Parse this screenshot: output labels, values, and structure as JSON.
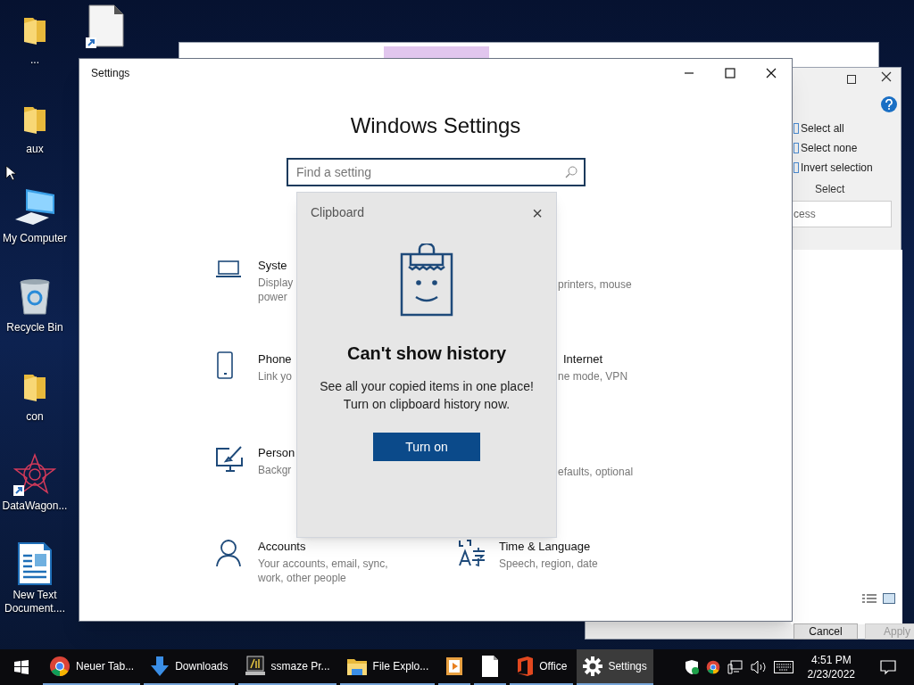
{
  "desktop_icons": [
    {
      "label": "..."
    },
    {
      "label": "aux"
    },
    {
      "label": "My Computer"
    },
    {
      "label": "Recycle Bin"
    },
    {
      "label": "con"
    },
    {
      "label": "DataWagon..."
    },
    {
      "label": "New Text Document...."
    }
  ],
  "explorer_window": {
    "ribbon_items": [
      "Select all",
      "Select none",
      "Invert selection"
    ],
    "group_label": "Select",
    "field_value": "cess",
    "buttons": [
      {
        "label": "Cancel",
        "disabled": false
      },
      {
        "label": "Apply",
        "disabled": true
      }
    ]
  },
  "settings_window": {
    "title": "Settings",
    "heading": "Windows Settings",
    "search": {
      "placeholder": "Find a setting"
    },
    "categories": [
      {
        "kind": "full",
        "title": "Syste",
        "description": "Display\npower"
      },
      {
        "kind": "partial",
        "description": "printers, mouse"
      },
      {
        "kind": "full",
        "title": "Phone",
        "description": "Link yo"
      },
      {
        "kind": "partial",
        "title": "Internet",
        "description": "ne mode, VPN"
      },
      {
        "kind": "full",
        "title": "Person",
        "description": "Backgr"
      },
      {
        "kind": "partial",
        "description": "efaults, optional"
      },
      {
        "kind": "full",
        "title": "Accounts",
        "description": "Your accounts, email, sync,\nwork, other people"
      },
      {
        "kind": "full",
        "title": "Time & Language",
        "description": "Speech, region, date"
      }
    ]
  },
  "clipboard_popup": {
    "title": "Clipboard",
    "close": "×",
    "heading": "Can't show history",
    "message": "See all your copied items in one place!\nTurn on clipboard history now.",
    "button": "Turn on"
  },
  "taskbar": {
    "items": [
      {
        "label": "Neuer Tab...",
        "selected": false
      },
      {
        "label": "Downloads",
        "selected": false
      },
      {
        "label": "ssmaze Pr...",
        "selected": false
      },
      {
        "label": "File Explo...",
        "selected": false
      },
      {
        "selected": false
      },
      {
        "selected": false
      },
      {
        "label": "Office",
        "selected": false
      },
      {
        "label": "Settings",
        "selected": true
      }
    ],
    "time": "4:51 PM",
    "date": "2/23/2022"
  }
}
